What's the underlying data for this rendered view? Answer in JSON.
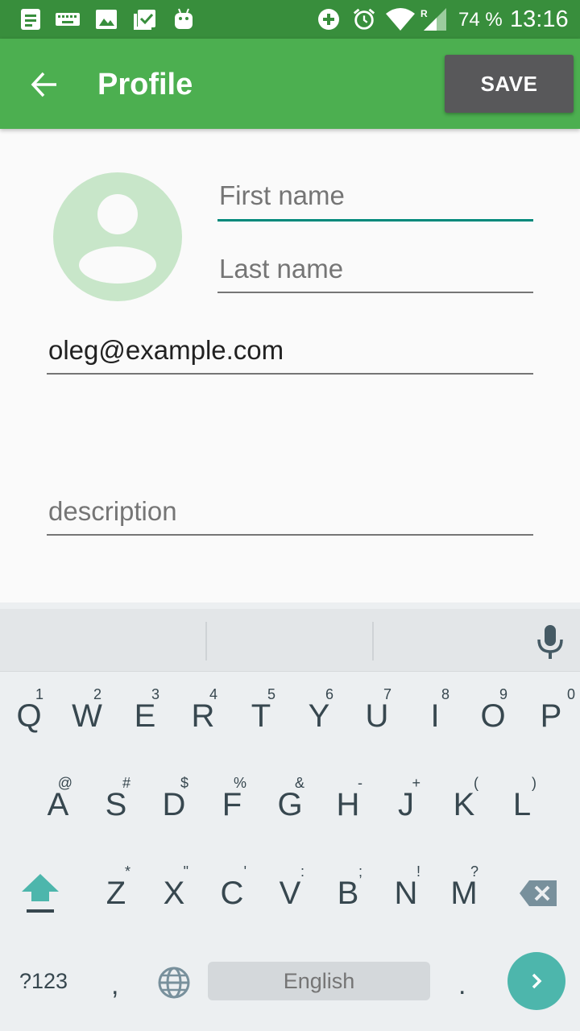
{
  "status_bar": {
    "battery": "74 %",
    "time": "13:16",
    "icons": [
      "notes-icon",
      "keyboard-icon",
      "image-icon",
      "clipboard-check-icon",
      "android-icon",
      "add-circle-icon",
      "alarm-icon",
      "wifi-icon",
      "signal-roaming-icon"
    ]
  },
  "app_bar": {
    "title": "Profile",
    "save_label": "SAVE",
    "back_icon": "arrow-back-icon",
    "color": "#4caf50"
  },
  "form": {
    "first_name_placeholder": "First name",
    "last_name_placeholder": "Last name",
    "email_value": "oleg@example.com",
    "description_placeholder": "description",
    "accent": "#00897b"
  },
  "keyboard": {
    "row1": [
      {
        "key": "Q",
        "hint": "1"
      },
      {
        "key": "W",
        "hint": "2"
      },
      {
        "key": "E",
        "hint": "3"
      },
      {
        "key": "R",
        "hint": "4"
      },
      {
        "key": "T",
        "hint": "5"
      },
      {
        "key": "Y",
        "hint": "6"
      },
      {
        "key": "U",
        "hint": "7"
      },
      {
        "key": "I",
        "hint": "8"
      },
      {
        "key": "O",
        "hint": "9"
      },
      {
        "key": "P",
        "hint": "0"
      }
    ],
    "row2": [
      {
        "key": "A",
        "hint": "@"
      },
      {
        "key": "S",
        "hint": "#"
      },
      {
        "key": "D",
        "hint": "$"
      },
      {
        "key": "F",
        "hint": "%"
      },
      {
        "key": "G",
        "hint": "&"
      },
      {
        "key": "H",
        "hint": "-"
      },
      {
        "key": "J",
        "hint": "+"
      },
      {
        "key": "K",
        "hint": "("
      },
      {
        "key": "L",
        "hint": ")"
      }
    ],
    "row3": [
      {
        "key": "Z",
        "hint": "*"
      },
      {
        "key": "X",
        "hint": "\""
      },
      {
        "key": "C",
        "hint": "'"
      },
      {
        "key": "V",
        "hint": ":"
      },
      {
        "key": "B",
        "hint": ";"
      },
      {
        "key": "N",
        "hint": "!"
      },
      {
        "key": "M",
        "hint": "?"
      }
    ],
    "symbols_label": "?123",
    "comma": ",",
    "period": ".",
    "space_label": "English",
    "enter_color": "#4db6ac"
  }
}
